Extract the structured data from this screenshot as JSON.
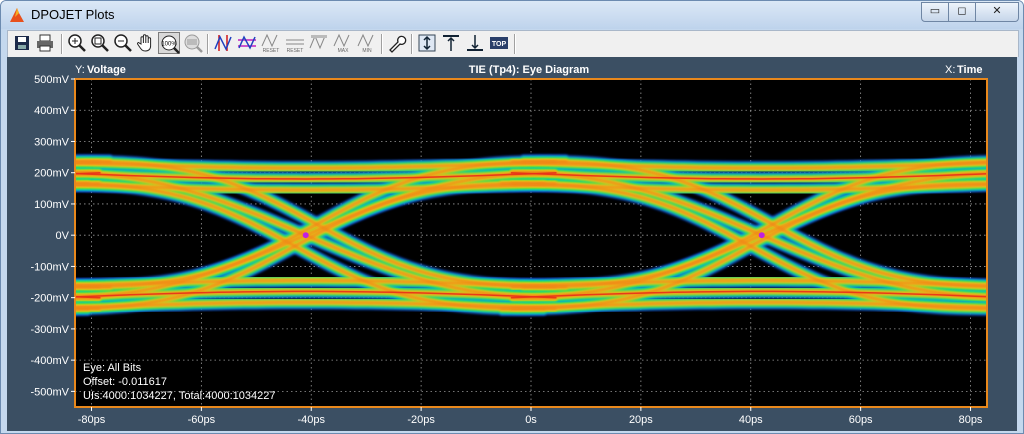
{
  "window": {
    "title": "DPOJET Plots",
    "min_glyph": "▭",
    "max_glyph": "◻",
    "close_glyph": "✕"
  },
  "toolbar": {
    "buttons": [
      {
        "name": "save-icon"
      },
      {
        "name": "print-icon"
      },
      {
        "name": "zoom-in-icon"
      },
      {
        "name": "zoom-box-icon"
      },
      {
        "name": "zoom-out-icon"
      },
      {
        "name": "pan-hand-icon"
      },
      {
        "name": "zoom-100-icon",
        "label": "100%"
      },
      {
        "name": "zoom-reset-icon"
      },
      {
        "name": "cursor-v-icon"
      },
      {
        "name": "cursor-h-icon"
      },
      {
        "name": "cursor-reset-icon",
        "label": "RESET"
      },
      {
        "name": "cursor-reset2-icon",
        "label": "RESET"
      },
      {
        "name": "marker-icon"
      },
      {
        "name": "marker-max-icon",
        "label": "MAX"
      },
      {
        "name": "marker-min-icon",
        "label": "MIN"
      },
      {
        "name": "wrench-icon"
      },
      {
        "name": "autoscale-v-icon"
      },
      {
        "name": "align-top-icon"
      },
      {
        "name": "align-bottom-icon"
      },
      {
        "name": "top-icon",
        "label": "TOP"
      }
    ]
  },
  "plot": {
    "y_label_prefix": "Y:",
    "y_label": "Voltage",
    "title": "TIE (Tp4): Eye Diagram",
    "x_label_prefix": "X:",
    "x_label": "Time",
    "annotations": [
      "Eye: All Bits",
      "Offset: -0.011617",
      "UIs:4000:1034227, Total:4000:1034227"
    ],
    "colors": {
      "frame": "#e8881c",
      "background": "#000000",
      "panel": "#3b4f63",
      "hot": "#e83018",
      "cold": "#2050d0"
    }
  },
  "chart_data": {
    "type": "heatmap",
    "title": "TIE (Tp4): Eye Diagram",
    "xlabel": "Time",
    "ylabel": "Voltage",
    "x_ticks": [
      "-80ps",
      "-60ps",
      "-40ps",
      "-20ps",
      "0s",
      "20ps",
      "40ps",
      "60ps",
      "80ps"
    ],
    "x_tick_values": [
      -80,
      -60,
      -40,
      -20,
      0,
      20,
      40,
      60,
      80
    ],
    "y_ticks": [
      "500mV",
      "400mV",
      "300mV",
      "200mV",
      "100mV",
      "0V",
      "-100mV",
      "-200mV",
      "-300mV",
      "-400mV",
      "-500mV"
    ],
    "y_tick_values": [
      500,
      400,
      300,
      200,
      100,
      0,
      -100,
      -200,
      -300,
      -400,
      -500
    ],
    "xlim": [
      -83,
      83
    ],
    "ylim": [
      -550,
      500
    ],
    "grid": true,
    "crossings_ps": [
      -41,
      42
    ],
    "levels_mV": [
      200,
      -200
    ],
    "level_spread_mV": 100
  }
}
